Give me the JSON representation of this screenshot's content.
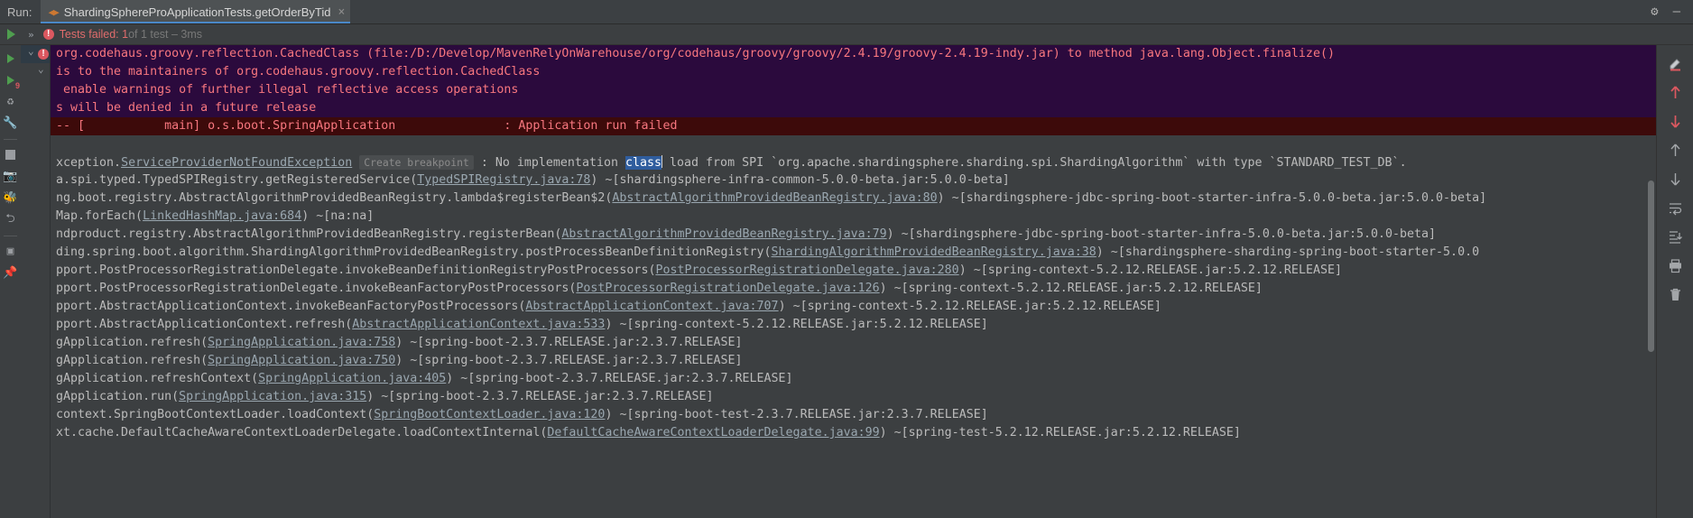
{
  "runbar": {
    "run_label": "Run:",
    "tab_title": "ShardingSphereProApplicationTests.getOrderByTid",
    "tab_close": "×",
    "settings_icon": "gear-icon",
    "minimize_icon": "minimize-icon"
  },
  "status": {
    "expand_chevron": "»",
    "badge": "!",
    "failed_text": "Tests failed: 1",
    "dim_text": " of 1 test – 3ms"
  },
  "left_tools": [
    {
      "name": "rerun-button",
      "glyph": "▶"
    },
    {
      "name": "rerun-failed-tests-button",
      "glyph": "▶",
      "badge": "9"
    },
    {
      "name": "toggle-auto-test-icon",
      "glyph": "↻"
    },
    {
      "name": "test-settings-icon",
      "glyph": "🔧"
    },
    {
      "name": "stop-button",
      "glyph": "■"
    },
    {
      "name": "export-test-results-icon",
      "glyph": "📷"
    },
    {
      "name": "debug-icon",
      "glyph": "🐞"
    },
    {
      "name": "import-test-results-icon",
      "glyph": "⮌"
    },
    {
      "name": "layout-settings-icon",
      "glyph": "▣"
    },
    {
      "name": "pin-tab-icon",
      "glyph": "📌"
    }
  ],
  "right_tools": [
    {
      "name": "highlighter-icon",
      "glyph": "✎"
    },
    {
      "name": "previous-occurrence-icon",
      "glyph": "↑",
      "red": true
    },
    {
      "name": "next-occurrence-icon",
      "glyph": "↓",
      "red": true
    },
    {
      "name": "scroll-up-icon",
      "glyph": "↑"
    },
    {
      "name": "scroll-down-icon",
      "glyph": "↓"
    },
    {
      "name": "soft-wrap-icon",
      "glyph": "↵"
    },
    {
      "name": "scroll-to-end-icon",
      "glyph": "⇥"
    },
    {
      "name": "print-icon",
      "glyph": "⎙"
    },
    {
      "name": "clear-all-icon",
      "glyph": "🗑"
    }
  ],
  "gutter": {
    "fold_chevron_1": "⌄",
    "fold_chevron_2": "⌄",
    "error_badge": "!"
  },
  "console": {
    "lines": [
      {
        "style": "warn",
        "parts": [
          {
            "t": "text",
            "v": "org.codehaus.groovy.reflection.CachedClass (file:/D:/Develop/MavenRelyOnWarehouse/org/codehaus/groovy/groovy/2.4.19/groovy-2.4.19-indy.jar) to method java.lang.Object.finalize()"
          }
        ]
      },
      {
        "style": "warn",
        "parts": [
          {
            "t": "text",
            "v": "is to the maintainers of org.codehaus.groovy.reflection.CachedClass"
          }
        ]
      },
      {
        "style": "warn",
        "parts": [
          {
            "t": "text",
            "v": " enable warnings of further illegal reflective access operations"
          }
        ]
      },
      {
        "style": "warn",
        "parts": [
          {
            "t": "text",
            "v": "s will be denied in a future release"
          }
        ]
      },
      {
        "style": "fatal",
        "parts": [
          {
            "t": "text",
            "v": "-- [           main] o.s.boot.SpringApplication               : Application run failed"
          }
        ]
      },
      {
        "style": "blank",
        "parts": []
      },
      {
        "style": "plain",
        "parts": [
          {
            "t": "text",
            "v": "xception."
          },
          {
            "t": "link",
            "v": "ServiceProviderNotFoundException"
          },
          {
            "t": "text",
            "v": " "
          },
          {
            "t": "bp",
            "v": "Create breakpoint"
          },
          {
            "t": "text",
            "v": " : No implementation "
          },
          {
            "t": "hl",
            "v": "class"
          },
          {
            "t": "caret",
            "v": ""
          },
          {
            "t": "text",
            "v": " load from SPI `org.apache.shardingsphere.sharding.spi.ShardingAlgorithm` with type `STANDARD_TEST_DB`."
          }
        ]
      },
      {
        "style": "plain",
        "parts": [
          {
            "t": "text",
            "v": "a.spi.typed.TypedSPIRegistry.getRegisteredService("
          },
          {
            "t": "link",
            "v": "TypedSPIRegistry.java:78"
          },
          {
            "t": "text",
            "v": ") ~[shardingsphere-infra-common-5.0.0-beta.jar:5.0.0-beta]"
          }
        ]
      },
      {
        "style": "plain",
        "parts": [
          {
            "t": "text",
            "v": "ng.boot.registry.AbstractAlgorithmProvidedBeanRegistry.lambda$registerBean$2("
          },
          {
            "t": "link",
            "v": "AbstractAlgorithmProvidedBeanRegistry.java:80"
          },
          {
            "t": "text",
            "v": ") ~[shardingsphere-jdbc-spring-boot-starter-infra-5.0.0-beta.jar:5.0.0-beta]"
          }
        ]
      },
      {
        "style": "plain",
        "parts": [
          {
            "t": "text",
            "v": "Map.forEach("
          },
          {
            "t": "link",
            "v": "LinkedHashMap.java:684"
          },
          {
            "t": "text",
            "v": ") ~[na:na]"
          }
        ]
      },
      {
        "style": "plain",
        "parts": [
          {
            "t": "text",
            "v": "ndproduct.registry.AbstractAlgorithmProvidedBeanRegistry.registerBean("
          },
          {
            "t": "link",
            "v": "AbstractAlgorithmProvidedBeanRegistry.java:79"
          },
          {
            "t": "text",
            "v": ") ~[shardingsphere-jdbc-spring-boot-starter-infra-5.0.0-beta.jar:5.0.0-beta]"
          }
        ]
      },
      {
        "style": "plain",
        "parts": [
          {
            "t": "text",
            "v": "ding.spring.boot.algorithm.ShardingAlgorithmProvidedBeanRegistry.postProcessBeanDefinitionRegistry("
          },
          {
            "t": "link",
            "v": "ShardingAlgorithmProvidedBeanRegistry.java:38"
          },
          {
            "t": "text",
            "v": ") ~[shardingsphere-sharding-spring-boot-starter-5.0.0"
          }
        ]
      },
      {
        "style": "plain",
        "parts": [
          {
            "t": "text",
            "v": "pport.PostProcessorRegistrationDelegate.invokeBeanDefinitionRegistryPostProcessors("
          },
          {
            "t": "link",
            "v": "PostProcessorRegistrationDelegate.java:280"
          },
          {
            "t": "text",
            "v": ") ~[spring-context-5.2.12.RELEASE.jar:5.2.12.RELEASE]"
          }
        ]
      },
      {
        "style": "plain",
        "parts": [
          {
            "t": "text",
            "v": "pport.PostProcessorRegistrationDelegate.invokeBeanFactoryPostProcessors("
          },
          {
            "t": "link",
            "v": "PostProcessorRegistrationDelegate.java:126"
          },
          {
            "t": "text",
            "v": ") ~[spring-context-5.2.12.RELEASE.jar:5.2.12.RELEASE]"
          }
        ]
      },
      {
        "style": "plain",
        "parts": [
          {
            "t": "text",
            "v": "pport.AbstractApplicationContext.invokeBeanFactoryPostProcessors("
          },
          {
            "t": "link",
            "v": "AbstractApplicationContext.java:707"
          },
          {
            "t": "text",
            "v": ") ~[spring-context-5.2.12.RELEASE.jar:5.2.12.RELEASE]"
          }
        ]
      },
      {
        "style": "plain",
        "parts": [
          {
            "t": "text",
            "v": "pport.AbstractApplicationContext.refresh("
          },
          {
            "t": "link",
            "v": "AbstractApplicationContext.java:533"
          },
          {
            "t": "text",
            "v": ") ~[spring-context-5.2.12.RELEASE.jar:5.2.12.RELEASE]"
          }
        ]
      },
      {
        "style": "plain",
        "parts": [
          {
            "t": "text",
            "v": "gApplication.refresh("
          },
          {
            "t": "link",
            "v": "SpringApplication.java:758"
          },
          {
            "t": "text",
            "v": ") ~[spring-boot-2.3.7.RELEASE.jar:2.3.7.RELEASE]"
          }
        ]
      },
      {
        "style": "plain",
        "parts": [
          {
            "t": "text",
            "v": "gApplication.refresh("
          },
          {
            "t": "link",
            "v": "SpringApplication.java:750"
          },
          {
            "t": "text",
            "v": ") ~[spring-boot-2.3.7.RELEASE.jar:2.3.7.RELEASE]"
          }
        ]
      },
      {
        "style": "plain",
        "parts": [
          {
            "t": "text",
            "v": "gApplication.refreshContext("
          },
          {
            "t": "link",
            "v": "SpringApplication.java:405"
          },
          {
            "t": "text",
            "v": ") ~[spring-boot-2.3.7.RELEASE.jar:2.3.7.RELEASE]"
          }
        ]
      },
      {
        "style": "plain",
        "parts": [
          {
            "t": "text",
            "v": "gApplication.run("
          },
          {
            "t": "link",
            "v": "SpringApplication.java:315"
          },
          {
            "t": "text",
            "v": ") ~[spring-boot-2.3.7.RELEASE.jar:2.3.7.RELEASE]"
          }
        ]
      },
      {
        "style": "plain",
        "parts": [
          {
            "t": "text",
            "v": "context.SpringBootContextLoader.loadContext("
          },
          {
            "t": "link",
            "v": "SpringBootContextLoader.java:120"
          },
          {
            "t": "text",
            "v": ") ~[spring-boot-test-2.3.7.RELEASE.jar:2.3.7.RELEASE]"
          }
        ]
      },
      {
        "style": "plain",
        "parts": [
          {
            "t": "text",
            "v": "xt.cache.DefaultCacheAwareContextLoaderDelegate.loadContextInternal("
          },
          {
            "t": "link",
            "v": "DefaultCacheAwareContextLoaderDelegate.java:99"
          },
          {
            "t": "text",
            "v": ") ~[spring-test-5.2.12.RELEASE.jar:5.2.12.RELEASE]"
          }
        ]
      }
    ]
  },
  "colors": {
    "background": "#3c3f41",
    "warn_bg": "#2b0a3d",
    "fatal_bg": "#3d0a0a",
    "warn_fg": "#f8777f",
    "selection": "#2f5d9e",
    "tab_underline": "#4a88c7",
    "error_red": "#db5860",
    "run_green": "#4f9e4f"
  }
}
